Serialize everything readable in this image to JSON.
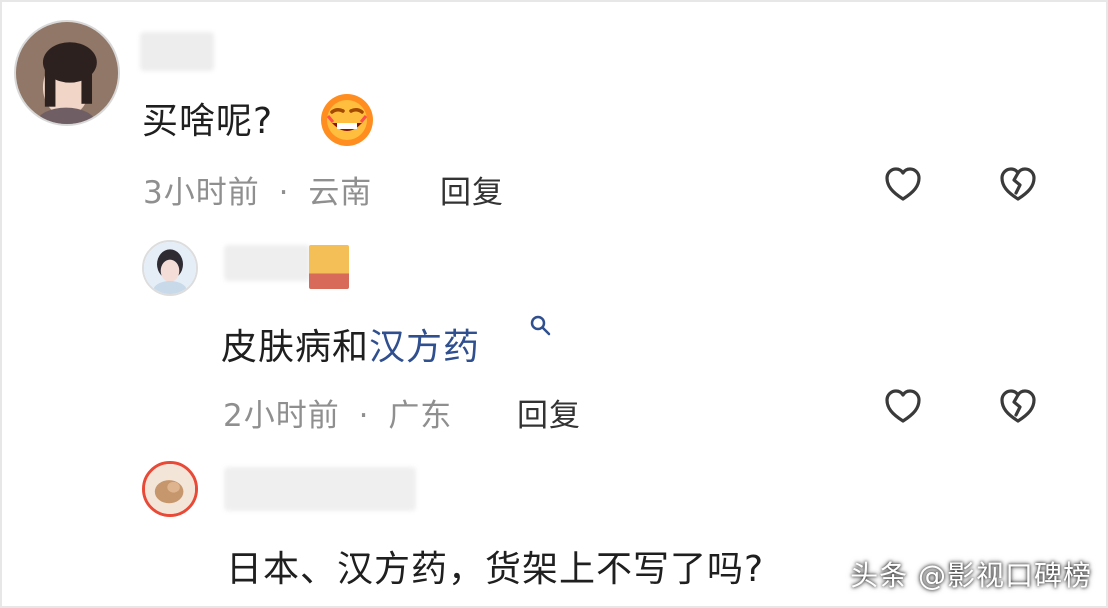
{
  "colors": {
    "link": "#2f4f8f",
    "meta": "#8f8f8f",
    "reply": "#333333",
    "accent_red": "#e84a37"
  },
  "comments": [
    {
      "text": "买啥呢?",
      "emoji": "laughing-face",
      "time": "3小时前",
      "separator": "·",
      "location": "云南",
      "reply_label": "回复",
      "icons": [
        "heart-icon",
        "broken-heart-icon"
      ]
    },
    {
      "text_prefix": "皮肤病和",
      "link_text": "汉方药",
      "time": "2小时前",
      "separator": "·",
      "location": "广东",
      "reply_label": "回复",
      "icons": [
        "search-icon",
        "heart-icon",
        "broken-heart-icon"
      ]
    },
    {
      "text": "日本、汉方药，货架上不写了吗?",
      "icons": []
    }
  ],
  "watermark": {
    "text": "头条 @影视口碑榜"
  }
}
